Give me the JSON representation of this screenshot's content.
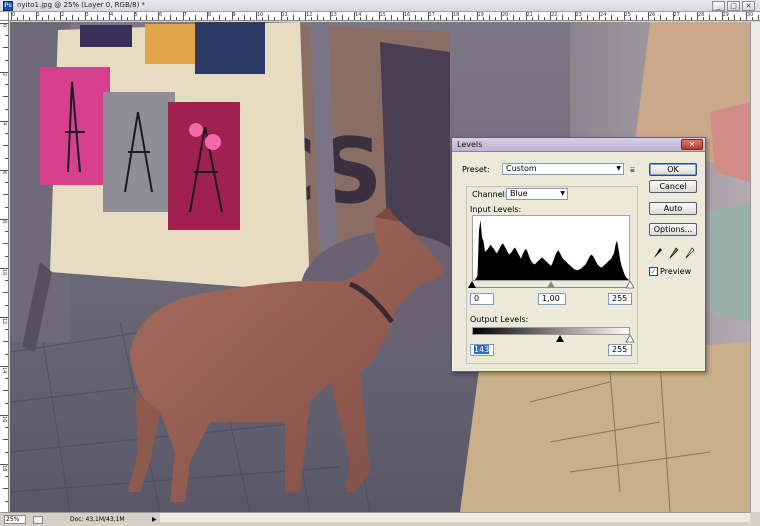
{
  "window": {
    "title": "nyito1.jpg @ 25% (Layer 0, RGB/8) *",
    "app_icon": "Ps",
    "buttons": [
      "_",
      "□",
      "✕"
    ]
  },
  "rulers": {
    "top_labels": [
      "0",
      "1",
      "2",
      "3",
      "4",
      "5",
      "6",
      "7",
      "8",
      "9",
      "10",
      "11",
      "12",
      "13",
      "14",
      "15",
      "16",
      "17",
      "18",
      "19",
      "20",
      "21",
      "22",
      "23",
      "24",
      "25",
      "26",
      "27",
      "28",
      "29",
      "30"
    ],
    "left_labels": [
      "0",
      "2",
      "4",
      "6",
      "8",
      "10",
      "12",
      "14",
      "16",
      "18",
      "20"
    ]
  },
  "status": {
    "zoom": "25%",
    "doc": "Doc: 43,1M/43,1M",
    "arrow": "▶"
  },
  "dialog": {
    "title": "Levels",
    "close": "✕",
    "preset_label": "Preset:",
    "preset_value": "Custom",
    "preset_menu_icon": "menu-icon",
    "channel_label": "Channel:",
    "channel_value": "Blue",
    "input_levels_label": "Input Levels:",
    "input_black": "0",
    "input_gamma": "1,00",
    "input_white": "255",
    "output_levels_label": "Output Levels:",
    "output_black": "143",
    "output_white": "255",
    "buttons": {
      "ok": "OK",
      "cancel": "Cancel",
      "auto": "Auto",
      "options": "Options..."
    },
    "preview_label": "Preview",
    "preview_checked": true,
    "eyedroppers": [
      "black-eyedropper-icon",
      "gray-eyedropper-icon",
      "white-eyedropper-icon"
    ]
  },
  "histogram": [
    0,
    0,
    2,
    6,
    70,
    85,
    60,
    55,
    40,
    42,
    44,
    48,
    50,
    46,
    44,
    40,
    38,
    42,
    46,
    50,
    52,
    48,
    44,
    40,
    36,
    38,
    40,
    44,
    46,
    42,
    38,
    34,
    30,
    36,
    40,
    44,
    42,
    36,
    30,
    26,
    24,
    22,
    24,
    26,
    28,
    30,
    32,
    30,
    28,
    26,
    24,
    22,
    20,
    24,
    30,
    36,
    40,
    42,
    38,
    34,
    30,
    28,
    26,
    24,
    22,
    20,
    18,
    16,
    15,
    14,
    14,
    15,
    16,
    18,
    20,
    22,
    26,
    30,
    34,
    36,
    34,
    30,
    26,
    22,
    20,
    18,
    18,
    20,
    22,
    24,
    26,
    28,
    30,
    34,
    38,
    50,
    56,
    44,
    30,
    20,
    14,
    8,
    4,
    2,
    0
  ],
  "colors": {
    "dialog_bg": "#ece9d8",
    "title_bar": "#bdb4d0",
    "selection": "#316ac5"
  }
}
